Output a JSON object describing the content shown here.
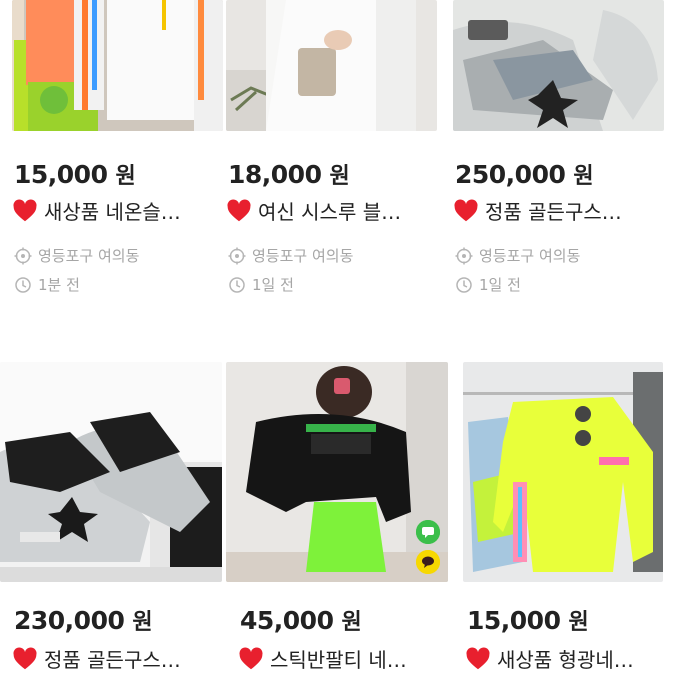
{
  "colors": {
    "price_text": "#222222",
    "meta_text": "#a6a6a6",
    "heart": "#e8202e"
  },
  "icons": {
    "title_prefix": "heart-icon",
    "location": "location-crosshair-icon",
    "time": "clock-icon"
  },
  "listings": [
    {
      "price": "15,000",
      "currency": "원",
      "title": "새상품 네온슬…",
      "location": "영등포구 여의동",
      "time": "1분 전",
      "image": "neon-clothes-rack"
    },
    {
      "price": "18,000",
      "currency": "원",
      "title": "여신 시스루 블…",
      "location": "영등포구 여의동",
      "time": "1일 전",
      "image": "white-see-through-blouse"
    },
    {
      "price": "250,000",
      "currency": "원",
      "title": "정품 골든구스…",
      "location": "영등포구 여의동",
      "time": "1일 전",
      "image": "golden-goose-sneakers-grey"
    },
    {
      "price": "230,000",
      "currency": "원",
      "title": "정품 골든구스…",
      "image": "golden-goose-sneakers-silver"
    },
    {
      "price": "45,000",
      "currency": "원",
      "title": "스틱반팔티 네…",
      "image": "black-tee-neon-skirt"
    },
    {
      "price": "15,000",
      "currency": "원",
      "title": "새상품 형광네…",
      "image": "neon-yellow-longsleeve"
    }
  ],
  "floating_buttons": {
    "chat": "chat-icon",
    "kakao": "kakao-talk-icon"
  }
}
